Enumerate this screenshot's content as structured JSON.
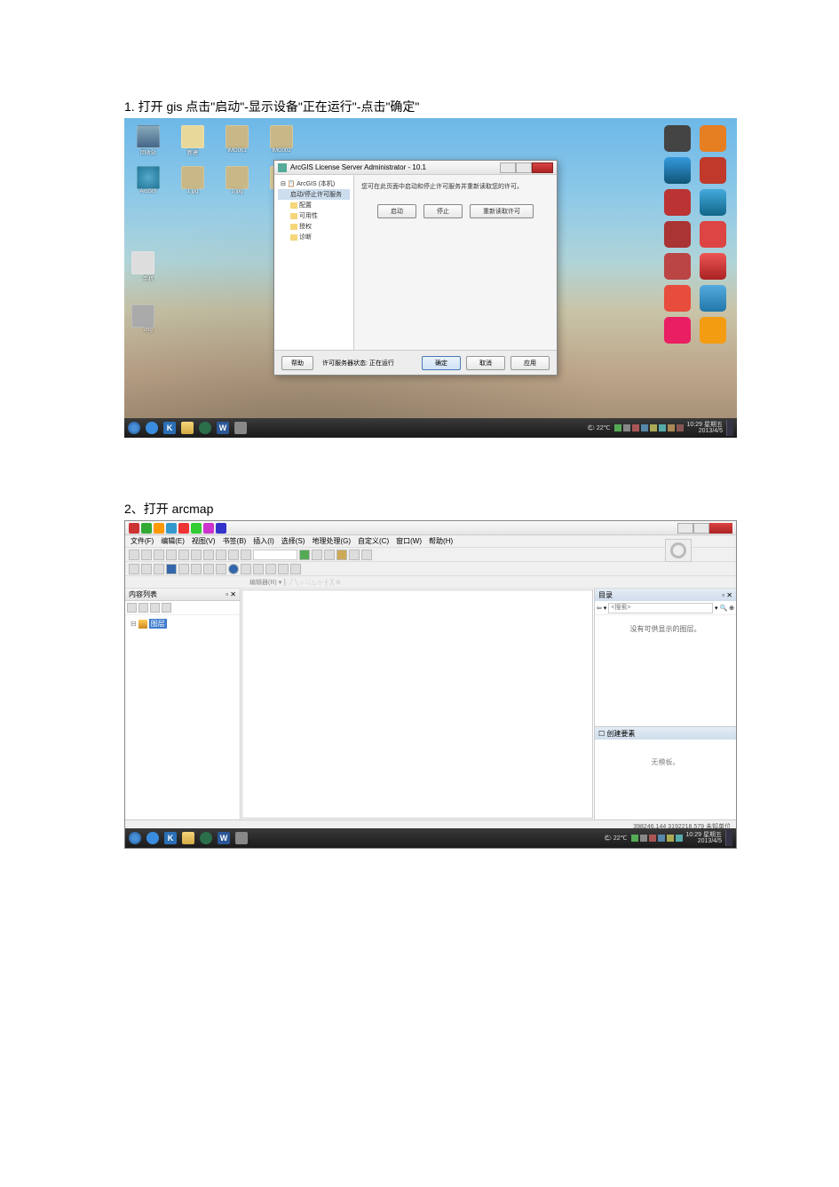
{
  "step1": {
    "text": "1. 打开 gis  点击\"启动\"-显示设备\"正在运行\"-点击\"确定\"",
    "dialog": {
      "title": "ArcGIS License Server Administrator - 10.1",
      "tree": {
        "root": "ArcGIS (本机)",
        "selected": "启动/停止许可服务",
        "items": [
          "配置",
          "可用性",
          "授权",
          "诊断"
        ]
      },
      "content_text": "您可在此页面中启动和停止许可服务并重新读取您的许可。",
      "buttons": {
        "start": "启动",
        "stop": "停止",
        "reread": "重新读取许可"
      },
      "help_btn": "帮助",
      "status_text": "许可服务器状态: 正在运行",
      "bottom": {
        "ok": "确定",
        "cancel": "取消",
        "apply": "应用"
      }
    },
    "taskbar": {
      "weather": "🌤 22℃",
      "time": "10:29 星期五",
      "date": "2013/4/5"
    },
    "desktop_icons": [
      "回收站",
      "新建文件",
      "IMG_001",
      "IMG_002",
      "ArcGIS",
      "1.jpg",
      "2.jpg"
    ]
  },
  "step2": {
    "text": "2、打开 arcmap",
    "arcmap": {
      "menu": [
        "文件(F)",
        "编辑(E)",
        "视图(V)",
        "书签(B)",
        "插入(I)",
        "选择(S)",
        "地理处理(G)",
        "自定义(C)",
        "窗口(W)",
        "帮助(H)"
      ],
      "editor_label": "编辑器(R)",
      "toc": {
        "header": "内容列表",
        "root": "图层"
      },
      "catalog": {
        "header": "目录",
        "search_placeholder": "<搜索>",
        "empty_text": "没有可供显示的图层。"
      },
      "create": {
        "header": "创建要素",
        "empty_text": "无模板。"
      },
      "status_coords": "398246.144 3192218.579 未知单位"
    },
    "taskbar": {
      "weather": "🌤 22℃",
      "time": "10:29 星期五",
      "date": "2013/4/5"
    }
  }
}
